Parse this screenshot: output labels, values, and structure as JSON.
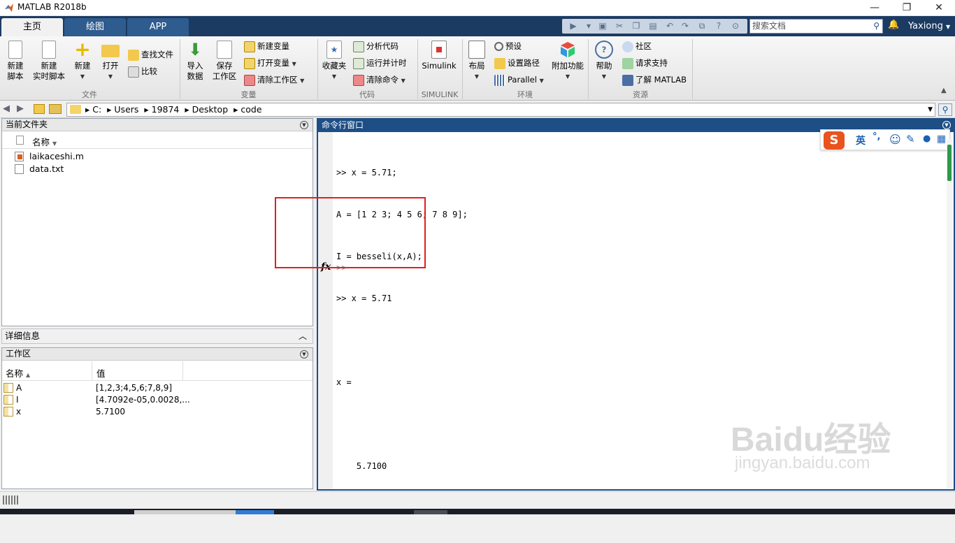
{
  "window": {
    "title": "MATLAB R2018b",
    "minimize": "—",
    "maximize": "❐",
    "close": "✕"
  },
  "tabs": [
    {
      "label": "主页"
    },
    {
      "label": "绘图"
    },
    {
      "label": "APP"
    }
  ],
  "search": {
    "placeholder": "搜索文档"
  },
  "user": {
    "name": "Yaxiong"
  },
  "ribbon": {
    "file": {
      "new_script": "新建\n脚本",
      "new_live_script": "新建\n实时脚本",
      "new": "新建",
      "open": "打开",
      "find_files": "查找文件",
      "compare": "比较",
      "group": "文件"
    },
    "variable": {
      "import": "导入\n数据",
      "save_ws": "保存\n工作区",
      "new_var": "新建变量",
      "open_var": "打开变量",
      "clear_ws": "清除工作区",
      "group": "变量"
    },
    "code": {
      "favorites": "收藏夹",
      "analyze": "分析代码",
      "run_time": "运行并计时",
      "clear_cmd": "清除命令",
      "group": "代码"
    },
    "simulink": {
      "label": "Simulink",
      "group": "SIMULINK"
    },
    "env": {
      "layout": "布局",
      "prefs": "预设",
      "set_path": "设置路径",
      "parallel": "Parallel",
      "addons": "附加功能",
      "group": "环境"
    },
    "resources": {
      "help": "帮助",
      "community": "社区",
      "request_support": "请求支持",
      "learn": "了解 MATLAB",
      "group": "资源"
    }
  },
  "path": {
    "segments": [
      "C:",
      "Users",
      "19874",
      "Desktop",
      "code"
    ]
  },
  "current_folder": {
    "title": "当前文件夹",
    "col_name": "名称",
    "files": [
      {
        "name": "laikaceshi.m"
      },
      {
        "name": "data.txt"
      }
    ]
  },
  "details": {
    "title": "详细信息"
  },
  "workspace": {
    "title": "工作区",
    "col_name": "名称",
    "col_value": "值",
    "rows": [
      {
        "name": "A",
        "value": "[1,2,3;4,5,6;7,8,9]"
      },
      {
        "name": "I",
        "value": "[4.7092e-05,0.0028,..."
      },
      {
        "name": "x",
        "value": "5.7100"
      }
    ]
  },
  "command_window": {
    "title": "命令行窗口",
    "lines": [
      ">> x = 5.71;",
      "A = [1 2 3; 4 5 6; 7 8 9];",
      "I = besseli(x,A);",
      ">> x = 5.71",
      "",
      "x =",
      "",
      "    5.7100",
      ""
    ],
    "prompt": ">>",
    "fx": "fx"
  },
  "ime": {
    "lang": "英",
    "punct": "°,"
  },
  "watermark": {
    "brand": "Baidu经验",
    "url": "jingyan.baidu.com"
  },
  "colors": {
    "accent": "#1d4e85",
    "tab_bar": "#1c3b63",
    "highlight": "#e0201b"
  }
}
